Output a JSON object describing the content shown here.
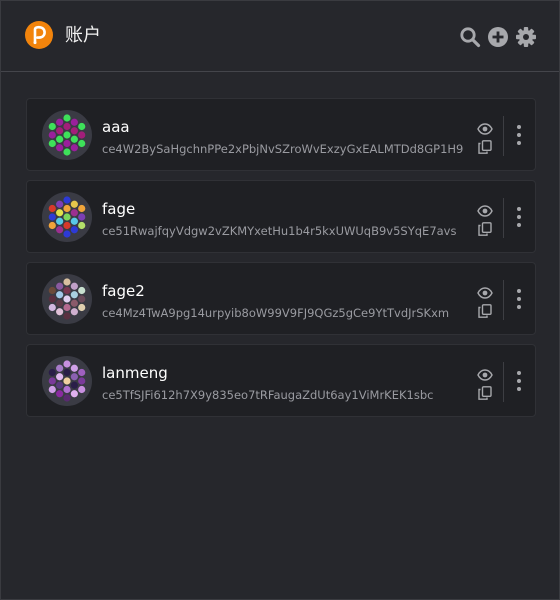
{
  "header": {
    "title": "账户",
    "logo_icon": "polkadot-logo-icon",
    "logo_color": "#f2840c",
    "actions": [
      "search-icon",
      "add-circle-icon",
      "gear-icon"
    ],
    "icon_color": "#a7a8ac"
  },
  "accounts": [
    {
      "name": "aaa",
      "address": "ce4W2BySaHgchnPPe2xPbjNvSZroWvExzyGxEALMTDd8GP1H9",
      "identicon": [
        "#3ee05a",
        "#9a1f9c",
        "#3ee05a",
        "#9a1f9c",
        "#a31e7a",
        "#3ee05a",
        "#9a1f9c",
        "#3ee05a",
        "#a31e7a",
        "#3ee05a",
        "#9a1f9c",
        "#3ee05a",
        "#9a1f9c",
        "#a31e7a",
        "#3ee05a",
        "#9a1f9c",
        "#3ee05a",
        "#a31e7a",
        "#3ee05a"
      ]
    },
    {
      "name": "fage",
      "address": "ce51RwajfqyVdgw2vZKMYxetHu1b4r5kxUWUqB9v5SYqE7avs",
      "identicon": [
        "#d8392a",
        "#2d3ad6",
        "#f0a43a",
        "#7c3fb5",
        "#e0e04a",
        "#58c9e6",
        "#9c2f90",
        "#2d3ad6",
        "#f0a43a",
        "#7cd65a",
        "#d8392a",
        "#2d3ad6",
        "#e7c74b",
        "#9c2f90",
        "#58c9e6",
        "#2d3ad6",
        "#f0a43a",
        "#7c3fb5",
        "#b3e06a"
      ]
    },
    {
      "name": "fage2",
      "address": "ce4Mz4TwA9pg14urpyib8oW99V9FJ9QGz5gCe9YtTvdJrSKxm",
      "identicon": [
        "#6b4a3a",
        "#5a2e3e",
        "#d3b8e0",
        "#8a5aa0",
        "#a0c8e6",
        "#5c3a48",
        "#e0c0d8",
        "#d8c0a0",
        "#7a3850",
        "#e0d0f0",
        "#b46a90",
        "#5a3040",
        "#c0a0c8",
        "#a8d0e0",
        "#8a5a6a",
        "#d0b0d0",
        "#c8e0d0",
        "#6a4a5a",
        "#e0d0b0"
      ]
    },
    {
      "name": "lanmeng",
      "address": "ce5TfSJFi612h7X9y835eo7tRFaugaZdUt6ay1ViMrKEK1sbc",
      "identicon": [
        "#2a1e48",
        "#7a3a9a",
        "#d0a0e8",
        "#a67ac8",
        "#e0b8f0",
        "#5a3a80",
        "#8a2aa0",
        "#c890e0",
        "#2a1e48",
        "#f0d0a0",
        "#b070d0",
        "#5a2a70",
        "#d0a0e8",
        "#8a60b0",
        "#2a1e48",
        "#e0b0f0",
        "#a060c0",
        "#7a3a9a",
        "#c890e0"
      ]
    }
  ],
  "card_actions": {
    "show_icon": "eye-icon",
    "copy_icon": "copy-icon",
    "menu_icon": "kebab-menu-icon"
  }
}
